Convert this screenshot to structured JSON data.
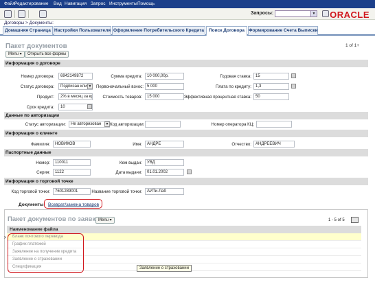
{
  "menubar": {
    "items": [
      "Файл",
      "Редактирование",
      "Вид",
      "Навигация",
      "Запрос",
      "Инструменты",
      "Помощь"
    ]
  },
  "toolbar": {
    "brand": "ORACLE",
    "queries_label": "Запросы:",
    "queries_value": ""
  },
  "breadcrumb": "Договоры > Документы:",
  "tabs": [
    {
      "label": "Домашняя Страница",
      "active": false
    },
    {
      "label": "Настройки Пользователя",
      "active": false
    },
    {
      "label": "Оформление Потребительского Кредита",
      "active": false
    },
    {
      "label": "Поиск Договора",
      "active": true
    },
    {
      "label": "Формирование Счета Выписки",
      "active": false
    }
  ],
  "page": {
    "title": "Пакет документов",
    "counter": "1 of 1+",
    "menu_label": "Menu",
    "open_all_label": "Открыть все формы"
  },
  "contract": {
    "section": "Информация о договоре",
    "number_label": "Номер договора:",
    "number": "6942149872",
    "status_label": "Статус договора:",
    "status": "Подписан клиенто",
    "product_label": "Продукт:",
    "product": "2% в месяц за кредит",
    "term_label": "Срок кредита:",
    "term": "10",
    "amount_label": "Сумма кредита:",
    "amount": "10 000,00р.",
    "down_payment_label": "Первоначальный взнос:",
    "down_payment": "5 000",
    "goods_cost_label": "Стоимость товаров:",
    "goods_cost": "15 000",
    "annual_rate_label": "Годовая ставка:",
    "annual_rate": "15",
    "credit_fee_label": "Плата по кредиту:",
    "credit_fee": "1,3",
    "effective_rate_label": "Эффективная процентная ставка:",
    "effective_rate": "50"
  },
  "authorization": {
    "section": "Данные по авторизации",
    "status_label": "Статус авторизации:",
    "status": "Не авторизован",
    "code_label": "Код авторизации:",
    "code": "",
    "operator_label": "Номер оператора КЦ:",
    "operator": ""
  },
  "client": {
    "section": "Информация о клиенте",
    "last_name_label": "Фамилия:",
    "last_name": "НОВИКОВ",
    "first_name_label": "Имя:",
    "first_name": "АНДРЕ",
    "patronymic_label": "Отчество:",
    "patronymic": "АНДРЕЕВИЧ"
  },
  "passport": {
    "section": "Паспортные данные",
    "number_label": "Номер:",
    "number": "110011",
    "series_label": "Серия:",
    "series": "1122",
    "issued_by_label": "Кем выдан:",
    "issued_by": "УВД",
    "issue_date_label": "Дата выдачи:",
    "issue_date": "01.01.2002"
  },
  "shop": {
    "section": "Информация о торговой точке",
    "code_label": "Код торговой точки:",
    "code": "7601289001",
    "name_label": "Название торговой точки:",
    "name": "АЙТи-Лаб"
  },
  "documents": {
    "tab_label": "Документы",
    "return_tab_label": "Возврат/замена товаров",
    "title": "Пакет документов по заявке",
    "menu_label": "Menu",
    "counter": "1 - 5 of 5",
    "column_header": "Наименование файла",
    "rows": [
      "Бланк почтового перевода",
      "График платежей",
      "Заявление на получение кредита",
      "Заявление о страховании",
      "Спецификация"
    ],
    "tooltip": "Заявление о страховании"
  },
  "colors": {
    "menubar": "#1b3f8a",
    "brand_red": "#d0161c",
    "section_bg": "#dcdcdc",
    "selected_row": "#ffffcc"
  }
}
